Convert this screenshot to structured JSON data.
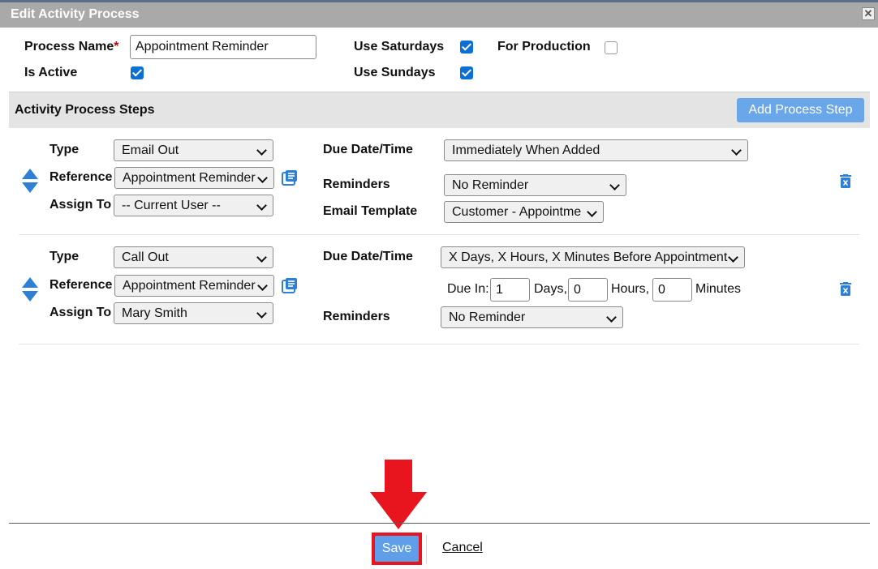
{
  "dialog": {
    "title": "Edit Activity Process",
    "close_glyph": "✕"
  },
  "form": {
    "process_name_label": "Process Name",
    "required_marker": "*",
    "process_name_value": "Appointment Reminder",
    "is_active_label": "Is Active",
    "is_active": true,
    "use_saturdays_label": "Use Saturdays",
    "use_saturdays": true,
    "use_sundays_label": "Use Sundays",
    "use_sundays": true,
    "for_production_label": "For Production",
    "for_production": false
  },
  "steps_section": {
    "title": "Activity Process Steps",
    "add_button_label": "Add Process Step"
  },
  "steps": [
    {
      "type_label": "Type",
      "type_value": "Email Out",
      "reference_label": "Reference",
      "reference_value": "Appointment Reminder",
      "assign_label": "Assign To",
      "assign_value": "-- Current User --",
      "due_label": "Due Date/Time",
      "due_value": "Immediately When Added",
      "reminders_label": "Reminders",
      "reminders_value": "No Reminder",
      "template_label": "Email Template",
      "template_value": "Customer - Appointme"
    },
    {
      "type_label": "Type",
      "type_value": "Call Out",
      "reference_label": "Reference",
      "reference_value": "Appointment Reminder",
      "assign_label": "Assign To",
      "assign_value": "Mary Smith",
      "due_label": "Due Date/Time",
      "due_value": "X Days, X Hours, X Minutes Before Appointment",
      "due_in_label": "Due In:",
      "days_value": "1",
      "days_label": "Days,",
      "hours_value": "0",
      "hours_label": "Hours,",
      "minutes_value": "0",
      "minutes_label": "Minutes",
      "reminders_label": "Reminders",
      "reminders_value": "No Reminder"
    }
  ],
  "footer": {
    "save_label": "Save",
    "cancel_label": "Cancel"
  },
  "colors": {
    "accent": "#6aa6ea",
    "checkbox": "#0b6fd4",
    "highlight": "#e8141e",
    "icon_blue": "#2e7fd6"
  },
  "icons": [
    "close-icon",
    "move-up-icon",
    "move-down-icon",
    "reference-list-icon",
    "delete-icon",
    "callout-arrow-icon"
  ]
}
